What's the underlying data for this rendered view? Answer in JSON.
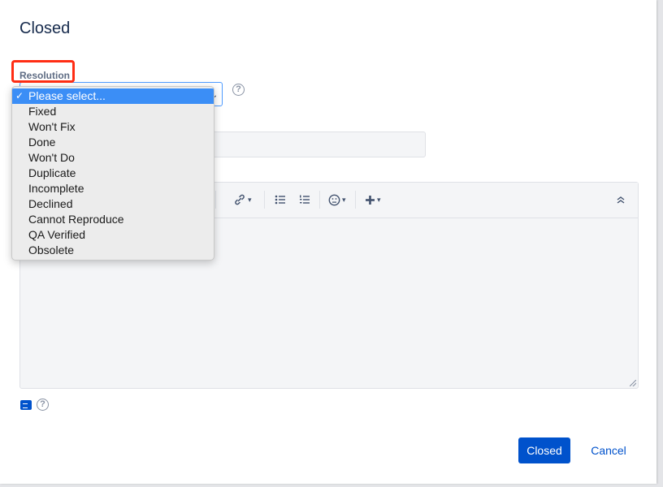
{
  "dialog": {
    "title": "Closed",
    "resolution": {
      "label": "Resolution",
      "options": [
        {
          "label": "Please select...",
          "selected": true
        },
        {
          "label": "Fixed",
          "selected": false
        },
        {
          "label": "Won't Fix",
          "selected": false
        },
        {
          "label": "Done",
          "selected": false
        },
        {
          "label": "Won't Do",
          "selected": false
        },
        {
          "label": "Duplicate",
          "selected": false
        },
        {
          "label": "Incomplete",
          "selected": false
        },
        {
          "label": "Declined",
          "selected": false
        },
        {
          "label": "Cannot Reproduce",
          "selected": false
        },
        {
          "label": "QA Verified",
          "selected": false
        },
        {
          "label": "Obsolete",
          "selected": false
        }
      ],
      "check_mark": "✓"
    },
    "help_glyph": "?",
    "toolbar": {
      "icons": [
        "link-icon",
        "bullet-list-icon",
        "numbered-list-icon",
        "emoji-icon",
        "insert-plus-icon",
        "collapse-toolbar-icon"
      ]
    },
    "footer": {
      "primary_label": "Closed",
      "cancel_label": "Cancel"
    },
    "colors": {
      "primary": "#0052cc",
      "highlight": "#ff2d14",
      "selected_option": "#3b8ef6"
    }
  }
}
